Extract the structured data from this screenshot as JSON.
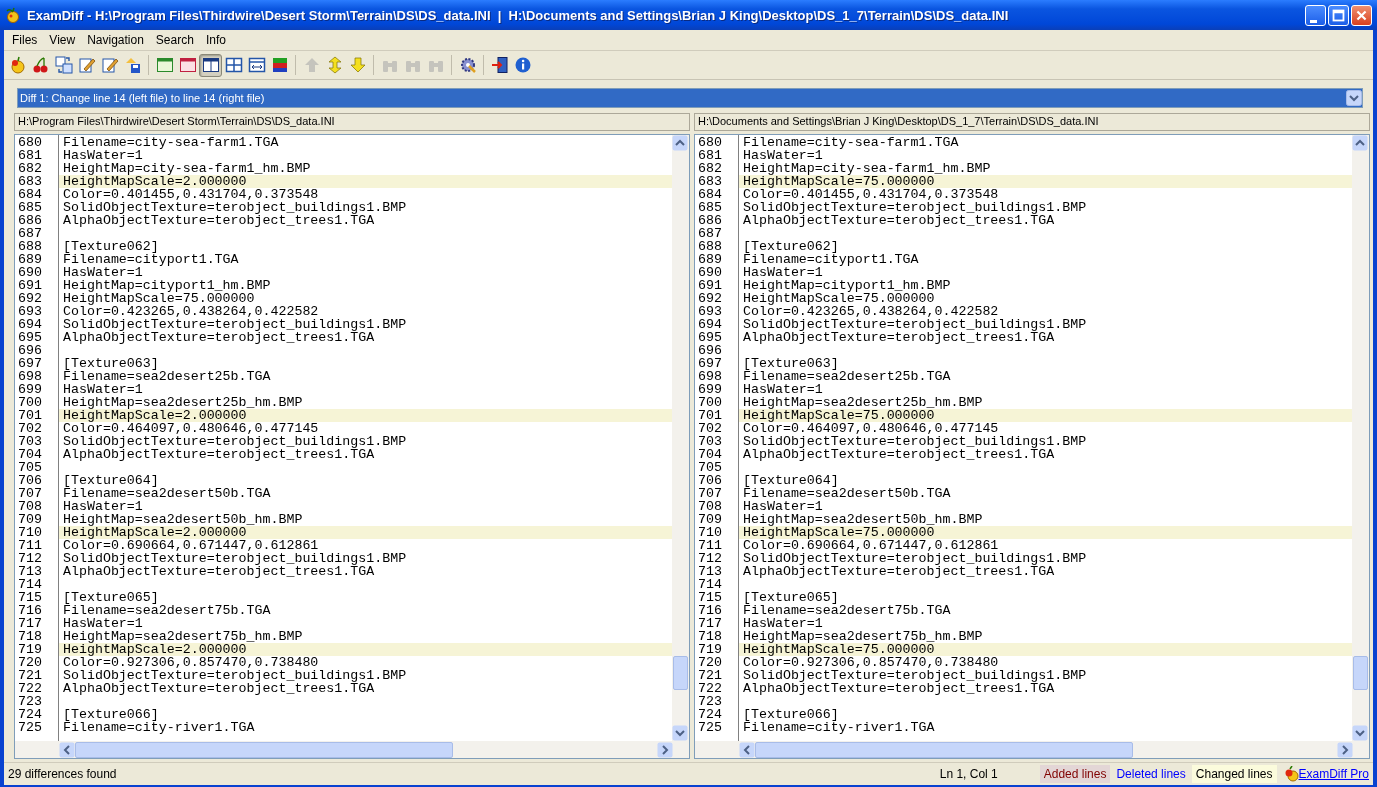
{
  "window": {
    "title": "ExamDiff - H:\\Program Files\\Thirdwire\\Desert Storm\\Terrain\\DS\\DS_data.INI  |  H:\\Documents and Settings\\Brian J King\\Desktop\\DS_1_7\\Terrain\\DS\\DS_data.INI"
  },
  "menu": [
    "Files",
    "View",
    "Navigation",
    "Search",
    "Info"
  ],
  "toolbar": [
    [
      {
        "kind": "apple",
        "selected": false,
        "disabled": false
      },
      {
        "kind": "cherry",
        "selected": false,
        "disabled": false
      },
      {
        "kind": "swap",
        "selected": false,
        "disabled": false
      },
      {
        "kind": "edit",
        "selected": false,
        "disabled": false
      },
      {
        "kind": "edit",
        "selected": false,
        "disabled": false
      },
      {
        "kind": "save",
        "selected": false,
        "disabled": false
      }
    ],
    [
      {
        "kind": "pane-green",
        "selected": false,
        "disabled": false
      },
      {
        "kind": "pane-red",
        "selected": false,
        "disabled": false
      },
      {
        "kind": "split",
        "selected": true,
        "disabled": false
      },
      {
        "kind": "grid",
        "selected": false,
        "disabled": false
      },
      {
        "kind": "grid-arrows",
        "selected": false,
        "disabled": false
      },
      {
        "kind": "colors",
        "selected": false,
        "disabled": false
      }
    ],
    [
      {
        "kind": "up",
        "selected": false,
        "disabled": true
      },
      {
        "kind": "updown",
        "selected": false,
        "disabled": false
      },
      {
        "kind": "down",
        "selected": false,
        "disabled": false
      }
    ],
    [
      {
        "kind": "binoculars",
        "selected": false,
        "disabled": true
      },
      {
        "kind": "binoculars",
        "selected": false,
        "disabled": true
      },
      {
        "kind": "binoculars",
        "selected": false,
        "disabled": true
      }
    ],
    [
      {
        "kind": "gear",
        "selected": false,
        "disabled": false
      }
    ],
    [
      {
        "kind": "exit",
        "selected": false,
        "disabled": false
      },
      {
        "kind": "info",
        "selected": false,
        "disabled": false
      }
    ]
  ],
  "diff_selector": {
    "value": "Diff 1: Change line 14 (left file) to line 14 (right file)"
  },
  "panes": [
    {
      "path": "H:\\Program Files\\Thirdwire\\Desert Storm\\Terrain\\DS\\DS_data.INI",
      "lines": [
        {
          "num": "680",
          "text": "Filename=city-sea-farm1.TGA",
          "changed": false
        },
        {
          "num": "681",
          "text": "HasWater=1",
          "changed": false
        },
        {
          "num": "682",
          "text": "HeightMap=city-sea-farm1_hm.BMP",
          "changed": false
        },
        {
          "num": "683",
          "text": "HeightMapScale=2.000000",
          "changed": true
        },
        {
          "num": "684",
          "text": "Color=0.401455,0.431704,0.373548",
          "changed": false
        },
        {
          "num": "685",
          "text": "SolidObjectTexture=terobject_buildings1.BMP",
          "changed": false
        },
        {
          "num": "686",
          "text": "AlphaObjectTexture=terobject_trees1.TGA",
          "changed": false
        },
        {
          "num": "687",
          "changed": false
        },
        {
          "num": "688",
          "text": "[Texture062]",
          "changed": false
        },
        {
          "num": "689",
          "text": "Filename=cityport1.TGA",
          "changed": false
        },
        {
          "num": "690",
          "text": "HasWater=1",
          "changed": false
        },
        {
          "num": "691",
          "text": "HeightMap=cityport1_hm.BMP",
          "changed": false
        },
        {
          "num": "692",
          "text": "HeightMapScale=75.000000",
          "changed": false
        },
        {
          "num": "693",
          "text": "Color=0.423265,0.438264,0.422582",
          "changed": false
        },
        {
          "num": "694",
          "text": "SolidObjectTexture=terobject_buildings1.BMP",
          "changed": false
        },
        {
          "num": "695",
          "text": "AlphaObjectTexture=terobject_trees1.TGA",
          "changed": false
        },
        {
          "num": "696",
          "changed": false
        },
        {
          "num": "697",
          "text": "[Texture063]",
          "changed": false
        },
        {
          "num": "698",
          "text": "Filename=sea2desert25b.TGA",
          "changed": false
        },
        {
          "num": "699",
          "text": "HasWater=1",
          "changed": false
        },
        {
          "num": "700",
          "text": "HeightMap=sea2desert25b_hm.BMP",
          "changed": false
        },
        {
          "num": "701",
          "text": "HeightMapScale=2.000000",
          "changed": true
        },
        {
          "num": "702",
          "text": "Color=0.464097,0.480646,0.477145",
          "changed": false
        },
        {
          "num": "703",
          "text": "SolidObjectTexture=terobject_buildings1.BMP",
          "changed": false
        },
        {
          "num": "704",
          "text": "AlphaObjectTexture=terobject_trees1.TGA",
          "changed": false
        },
        {
          "num": "705",
          "changed": false
        },
        {
          "num": "706",
          "text": "[Texture064]",
          "changed": false
        },
        {
          "num": "707",
          "text": "Filename=sea2desert50b.TGA",
          "changed": false
        },
        {
          "num": "708",
          "text": "HasWater=1",
          "changed": false
        },
        {
          "num": "709",
          "text": "HeightMap=sea2desert50b_hm.BMP",
          "changed": false
        },
        {
          "num": "710",
          "text": "HeightMapScale=2.000000",
          "changed": true
        },
        {
          "num": "711",
          "text": "Color=0.690664,0.671447,0.612861",
          "changed": false
        },
        {
          "num": "712",
          "text": "SolidObjectTexture=terobject_buildings1.BMP",
          "changed": false
        },
        {
          "num": "713",
          "text": "AlphaObjectTexture=terobject_trees1.TGA",
          "changed": false
        },
        {
          "num": "714",
          "changed": false
        },
        {
          "num": "715",
          "text": "[Texture065]",
          "changed": false
        },
        {
          "num": "716",
          "text": "Filename=sea2desert75b.TGA",
          "changed": false
        },
        {
          "num": "717",
          "text": "HasWater=1",
          "changed": false
        },
        {
          "num": "718",
          "text": "HeightMap=sea2desert75b_hm.BMP",
          "changed": false
        },
        {
          "num": "719",
          "text": "HeightMapScale=2.000000",
          "changed": true
        },
        {
          "num": "720",
          "text": "Color=0.927306,0.857470,0.738480",
          "changed": false
        },
        {
          "num": "721",
          "text": "SolidObjectTexture=terobject_buildings1.BMP",
          "changed": false
        },
        {
          "num": "722",
          "text": "AlphaObjectTexture=terobject_trees1.TGA",
          "changed": false
        },
        {
          "num": "723",
          "changed": false
        },
        {
          "num": "724",
          "text": "[Texture066]",
          "changed": false
        },
        {
          "num": "725",
          "text": "Filename=city-river1.TGA",
          "changed": false
        }
      ]
    },
    {
      "path": "H:\\Documents and Settings\\Brian J King\\Desktop\\DS_1_7\\Terrain\\DS\\DS_data.INI",
      "lines": [
        {
          "num": "680",
          "text": "Filename=city-sea-farm1.TGA",
          "changed": false
        },
        {
          "num": "681",
          "text": "HasWater=1",
          "changed": false
        },
        {
          "num": "682",
          "text": "HeightMap=city-sea-farm1_hm.BMP",
          "changed": false
        },
        {
          "num": "683",
          "text": "HeightMapScale=75.000000",
          "changed": true
        },
        {
          "num": "684",
          "text": "Color=0.401455,0.431704,0.373548",
          "changed": false
        },
        {
          "num": "685",
          "text": "SolidObjectTexture=terobject_buildings1.BMP",
          "changed": false
        },
        {
          "num": "686",
          "text": "AlphaObjectTexture=terobject_trees1.TGA",
          "changed": false
        },
        {
          "num": "687",
          "changed": false
        },
        {
          "num": "688",
          "text": "[Texture062]",
          "changed": false
        },
        {
          "num": "689",
          "text": "Filename=cityport1.TGA",
          "changed": false
        },
        {
          "num": "690",
          "text": "HasWater=1",
          "changed": false
        },
        {
          "num": "691",
          "text": "HeightMap=cityport1_hm.BMP",
          "changed": false
        },
        {
          "num": "692",
          "text": "HeightMapScale=75.000000",
          "changed": false
        },
        {
          "num": "693",
          "text": "Color=0.423265,0.438264,0.422582",
          "changed": false
        },
        {
          "num": "694",
          "text": "SolidObjectTexture=terobject_buildings1.BMP",
          "changed": false
        },
        {
          "num": "695",
          "text": "AlphaObjectTexture=terobject_trees1.TGA",
          "changed": false
        },
        {
          "num": "696",
          "changed": false
        },
        {
          "num": "697",
          "text": "[Texture063]",
          "changed": false
        },
        {
          "num": "698",
          "text": "Filename=sea2desert25b.TGA",
          "changed": false
        },
        {
          "num": "699",
          "text": "HasWater=1",
          "changed": false
        },
        {
          "num": "700",
          "text": "HeightMap=sea2desert25b_hm.BMP",
          "changed": false
        },
        {
          "num": "701",
          "text": "HeightMapScale=75.000000",
          "changed": true
        },
        {
          "num": "702",
          "text": "Color=0.464097,0.480646,0.477145",
          "changed": false
        },
        {
          "num": "703",
          "text": "SolidObjectTexture=terobject_buildings1.BMP",
          "changed": false
        },
        {
          "num": "704",
          "text": "AlphaObjectTexture=terobject_trees1.TGA",
          "changed": false
        },
        {
          "num": "705",
          "changed": false
        },
        {
          "num": "706",
          "text": "[Texture064]",
          "changed": false
        },
        {
          "num": "707",
          "text": "Filename=sea2desert50b.TGA",
          "changed": false
        },
        {
          "num": "708",
          "text": "HasWater=1",
          "changed": false
        },
        {
          "num": "709",
          "text": "HeightMap=sea2desert50b_hm.BMP",
          "changed": false
        },
        {
          "num": "710",
          "text": "HeightMapScale=75.000000",
          "changed": true
        },
        {
          "num": "711",
          "text": "Color=0.690664,0.671447,0.612861",
          "changed": false
        },
        {
          "num": "712",
          "text": "SolidObjectTexture=terobject_buildings1.BMP",
          "changed": false
        },
        {
          "num": "713",
          "text": "AlphaObjectTexture=terobject_trees1.TGA",
          "changed": false
        },
        {
          "num": "714",
          "changed": false
        },
        {
          "num": "715",
          "text": "[Texture065]",
          "changed": false
        },
        {
          "num": "716",
          "text": "Filename=sea2desert75b.TGA",
          "changed": false
        },
        {
          "num": "717",
          "text": "HasWater=1",
          "changed": false
        },
        {
          "num": "718",
          "text": "HeightMap=sea2desert75b_hm.BMP",
          "changed": false
        },
        {
          "num": "719",
          "text": "HeightMapScale=75.000000",
          "changed": true
        },
        {
          "num": "720",
          "text": "Color=0.927306,0.857470,0.738480",
          "changed": false
        },
        {
          "num": "721",
          "text": "SolidObjectTexture=terobject_buildings1.BMP",
          "changed": false
        },
        {
          "num": "722",
          "text": "AlphaObjectTexture=terobject_trees1.TGA",
          "changed": false
        },
        {
          "num": "723",
          "changed": false
        },
        {
          "num": "724",
          "text": "[Texture066]",
          "changed": false
        },
        {
          "num": "725",
          "text": "Filename=city-river1.TGA",
          "changed": false
        }
      ]
    }
  ],
  "status_bar": {
    "message": "29 differences found",
    "position": "Ln 1, Col 1",
    "legend": [
      {
        "kind": "added",
        "label": "Added lines",
        "color": "#800000"
      },
      {
        "kind": "deleted",
        "label": "Deleted lines",
        "color": "#0000ff"
      },
      {
        "kind": "changed",
        "label": "Changed lines",
        "color": "#000000"
      }
    ],
    "link": "ExamDiff Pro"
  }
}
